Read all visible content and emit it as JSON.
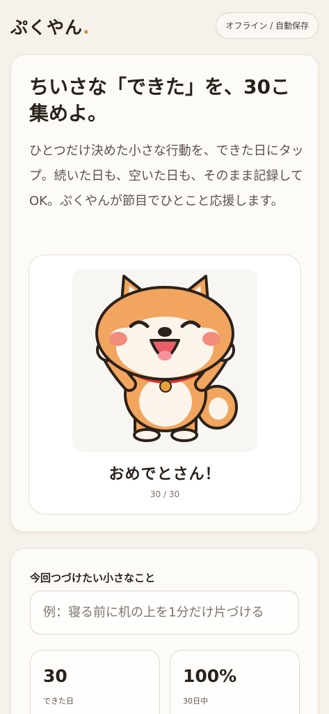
{
  "header": {
    "logo_text": "ぷくやん",
    "logo_dot": ".",
    "status_label": "オフライン / 自動保存"
  },
  "hero": {
    "title": "ちいさな「できた」を、30こ集めよ。",
    "description": "ひとつだけ決めた小さな行動を、できた日にタップ。続いた日も、空いた日も、そのまま記録してOK。ぷくやんが節目でひとこと応援します。",
    "mascot_icon": "shiba-dog-cheering-icon",
    "mascot_caption": "おめでとさん！",
    "mascot_count": "30 / 30"
  },
  "goal": {
    "label": "今回つづけたい小さなこと",
    "placeholder": "例：寝る前に机の上を1分だけ片づける",
    "value": ""
  },
  "stats": [
    {
      "value": "30",
      "label": "できた日"
    },
    {
      "value": "100%",
      "label": "30日中"
    }
  ],
  "colors": {
    "background": "#f6f1ea",
    "accent": "#d98a3a",
    "card": "#fdfbf8",
    "text": "#2a211b"
  }
}
